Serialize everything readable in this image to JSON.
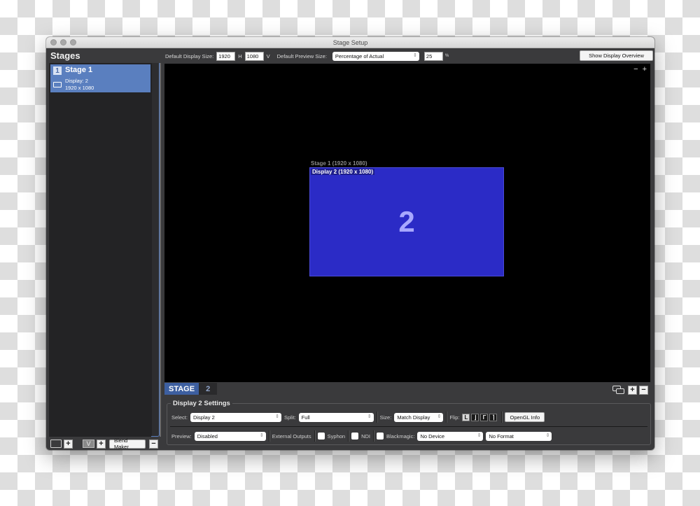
{
  "window": {
    "title": "Stage Setup"
  },
  "sidebar": {
    "title": "Stages",
    "stages": [
      {
        "number": "1",
        "name": "Stage 1",
        "display": "Display: 2",
        "resolution": "1920 x 1080"
      }
    ],
    "bottom": {
      "add_label": "+",
      "v_label": "V",
      "add2_label": "+",
      "blend_maker_label": "Blend Maker",
      "remove_label": "−"
    }
  },
  "toolbar": {
    "default_display_size_label": "Default Display Size:",
    "width_value": "1920",
    "h_label": "H",
    "height_value": "1080",
    "v_label": "V",
    "default_preview_size_label": "Default Preview Size:",
    "preview_mode": "Percentage of Actual",
    "preview_percent": "25",
    "percent_sign": "%",
    "show_overview_label": "Show Display Overview"
  },
  "canvas": {
    "zoom_out": "−",
    "zoom_in": "+",
    "stage_label": "Stage 1 (1920 x 1080)",
    "display_label": "Display 2 (1920 x 1080)",
    "display_number": "2",
    "display_color": "#2b2bc6"
  },
  "tabs": [
    {
      "label": "STAGE",
      "active": true
    },
    {
      "label": "2",
      "active": false
    }
  ],
  "tab_controls": {
    "add": "+",
    "remove": "−"
  },
  "settings": {
    "title": "Display 2 Settings",
    "select_label": "Select:",
    "select_value": "Display 2",
    "split_label": "Split:",
    "split_value": "Full",
    "size_label": "Size:",
    "size_value": "Match Display",
    "flip_label": "Flip:",
    "flip_options": [
      "L",
      "⌋",
      "Γ",
      "⌉"
    ],
    "opengl_label": "OpenGL Info",
    "preview_label": "Preview:",
    "preview_value": "Disabled",
    "external_outputs_label": "External Outputs",
    "syphon_label": "Syphon",
    "ndi_label": "NDI",
    "blackmagic_label": "Blackmagic:",
    "device_value": "No Device",
    "format_value": "No Format"
  }
}
